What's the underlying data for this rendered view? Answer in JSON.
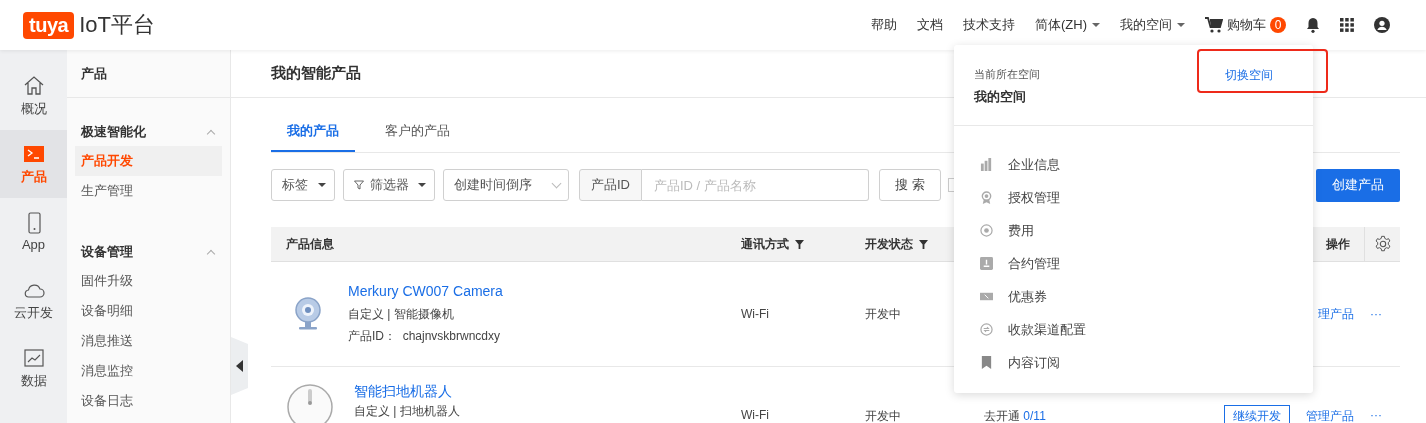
{
  "logo": {
    "brand": "tuya",
    "title": "IoT平台"
  },
  "top_nav": [
    {
      "kind": "link",
      "label": "帮助"
    },
    {
      "kind": "link",
      "label": "文档"
    },
    {
      "kind": "link",
      "label": "技术支持"
    },
    {
      "kind": "menu",
      "label": "简体(ZH)"
    },
    {
      "kind": "menu",
      "label": "我的空间"
    },
    {
      "kind": "cart",
      "label": "购物车",
      "badge": "0"
    },
    {
      "kind": "bell"
    },
    {
      "kind": "apps"
    },
    {
      "kind": "user"
    }
  ],
  "rail": [
    {
      "label": "概况",
      "selected": false
    },
    {
      "label": "产品",
      "selected": true
    },
    {
      "label": "App",
      "selected": false
    },
    {
      "label": "云开发",
      "selected": false
    },
    {
      "label": "数据",
      "selected": false
    }
  ],
  "sidebar": {
    "title": "产品",
    "groups": [
      {
        "title": "极速智能化",
        "expanded": true,
        "items": [
          {
            "label": "产品开发",
            "selected": true
          },
          {
            "label": "生产管理",
            "selected": false
          }
        ]
      },
      {
        "title": "设备管理",
        "expanded": true,
        "items": [
          {
            "label": "固件升级",
            "selected": false
          },
          {
            "label": "设备明细",
            "selected": false
          },
          {
            "label": "消息推送",
            "selected": false
          },
          {
            "label": "消息监控",
            "selected": false
          },
          {
            "label": "设备日志",
            "selected": false
          }
        ]
      }
    ]
  },
  "page_title": "我的智能产品",
  "tabs": [
    {
      "label": "我的产品",
      "selected": true
    },
    {
      "label": "客户的产品",
      "selected": false
    }
  ],
  "filters": {
    "tag": "标签",
    "filter": "筛选器",
    "sort": "创建时间倒序",
    "id_label": "产品ID",
    "search_placeholder": "产品ID / 产品名称",
    "search_button": "搜 索",
    "checked": false,
    "create_button": "创建产品"
  },
  "table": {
    "columns": [
      {
        "label": "产品信息",
        "filter": false
      },
      {
        "label": "通讯方式",
        "filter": true
      },
      {
        "label": "开发状态",
        "filter": true
      },
      {
        "label": "操作",
        "filter": false
      }
    ],
    "rows": [
      {
        "name": "Merkury CW007 Camera",
        "category": "自定义  |  智能摄像机",
        "id_label": "产品ID：",
        "product_id": "chajnvskbrwncdxy",
        "comm": "Wi-Fi",
        "status": "开发中",
        "actions": [
          {
            "kind": "link",
            "label": "理产品"
          },
          {
            "kind": "more",
            "label": "···"
          }
        ]
      },
      {
        "name": "智能扫地机器人",
        "category": "自定义  |  扫地机器人",
        "comm": "Wi-Fi",
        "status": "开发中",
        "activation": "去开通",
        "count": "0/11",
        "actions": [
          {
            "kind": "outline",
            "label": "继续开发"
          },
          {
            "kind": "link",
            "label": "管理产品"
          },
          {
            "kind": "more",
            "label": "···"
          }
        ]
      }
    ]
  },
  "space_menu": {
    "caption": "当前所在空间",
    "current": "我的空间",
    "switch": "切换空间",
    "switch_highlighted": true,
    "items": [
      {
        "label": "企业信息"
      },
      {
        "label": "授权管理"
      },
      {
        "label": "费用"
      },
      {
        "label": "合约管理"
      },
      {
        "label": "优惠券"
      },
      {
        "label": "收款渠道配置"
      },
      {
        "label": "内容订阅"
      }
    ]
  }
}
